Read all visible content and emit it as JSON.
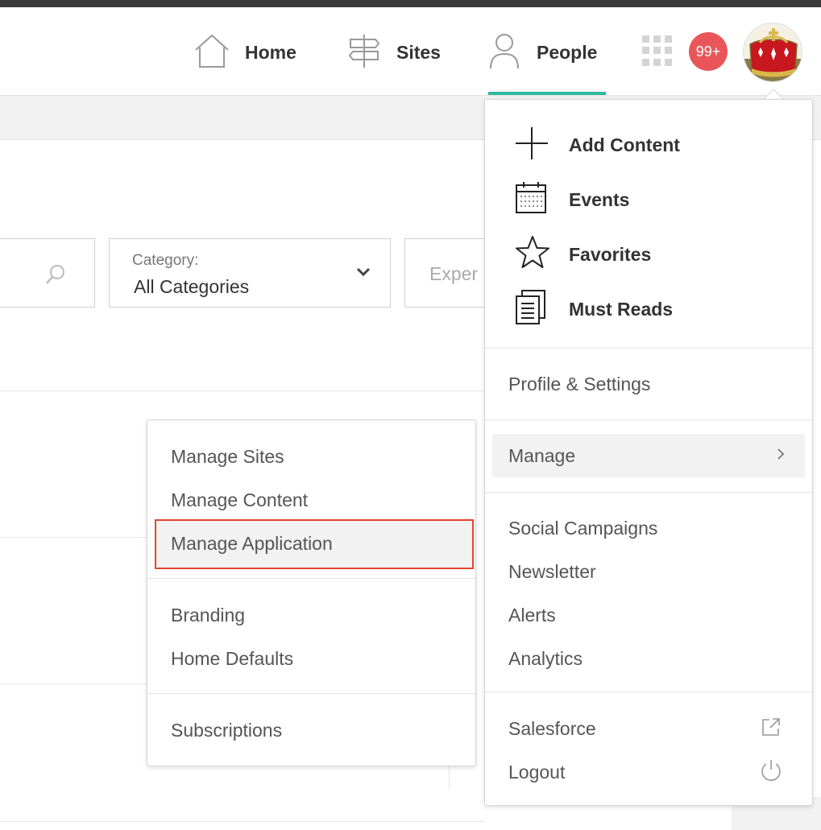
{
  "header": {
    "nav": [
      {
        "label": "Home",
        "icon": "home-icon"
      },
      {
        "label": "Sites",
        "icon": "signpost-icon"
      },
      {
        "label": "People",
        "icon": "person-icon",
        "active": true
      }
    ],
    "apps_icon": "apps-grid-icon",
    "notifications_badge": "99+",
    "avatar_icon": "crown-crest-avatar"
  },
  "filters": {
    "search_icon": "search-icon",
    "category_label": "Category:",
    "category_value": "All Categories",
    "expertise_placeholder": "Exper"
  },
  "user_menu": {
    "quick_items": [
      {
        "label": "Add Content",
        "icon": "plus-icon"
      },
      {
        "label": "Events",
        "icon": "calendar-icon"
      },
      {
        "label": "Favorites",
        "icon": "star-icon"
      },
      {
        "label": "Must Reads",
        "icon": "document-icon"
      }
    ],
    "profile_settings": "Profile & Settings",
    "manage": "Manage",
    "tools": [
      "Social Campaigns",
      "Newsletter",
      "Alerts",
      "Analytics"
    ],
    "salesforce": "Salesforce",
    "logout": "Logout"
  },
  "manage_submenu": {
    "group1": [
      "Manage Sites",
      "Manage Content",
      "Manage Application"
    ],
    "group2": [
      "Branding",
      "Home Defaults"
    ],
    "group3": [
      "Subscriptions"
    ],
    "highlighted": "Manage Application",
    "highlight_color": "#e5432f"
  },
  "colors": {
    "accent": "#2fb8a0",
    "badge": "#e8565a"
  }
}
